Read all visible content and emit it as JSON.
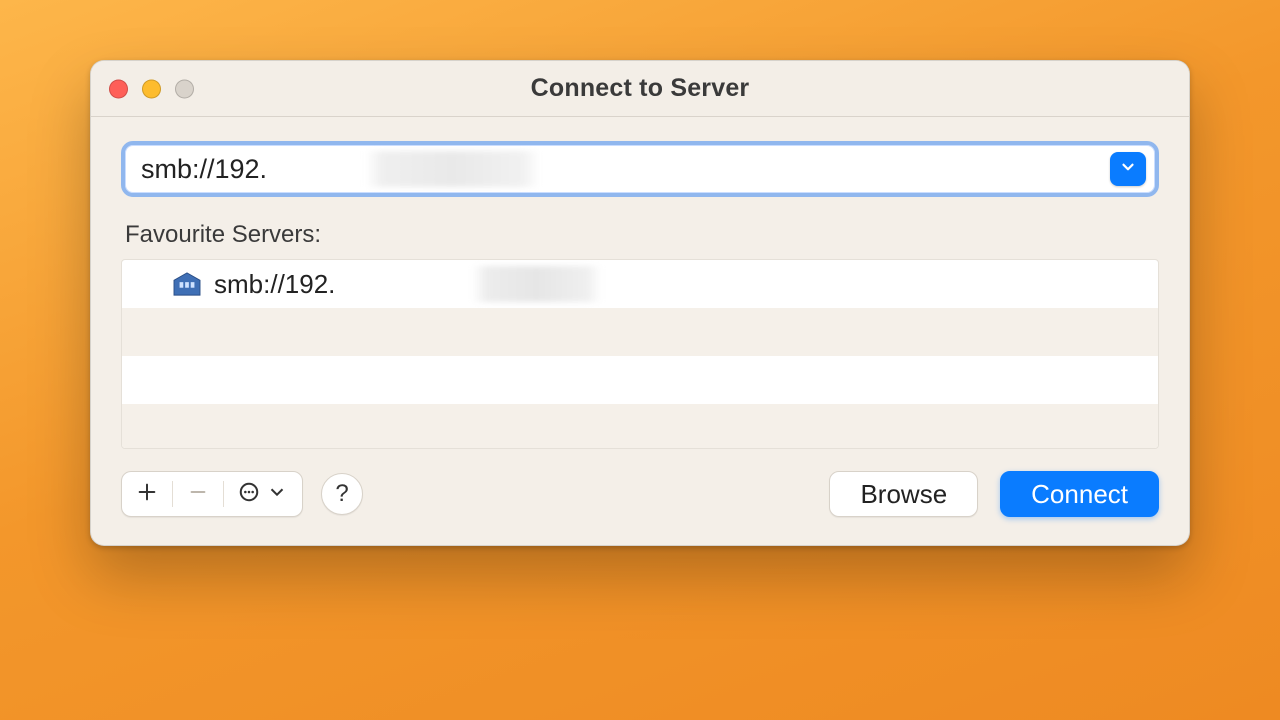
{
  "window": {
    "title": "Connect to Server"
  },
  "colors": {
    "accent": "#0a7cff",
    "focus_ring": "#90b7ee",
    "background_outer": "#f3972b",
    "window_bg": "#f4efe8"
  },
  "address": {
    "value": "smb://192.",
    "placeholder": ""
  },
  "icons": {
    "history_dropdown": "chevron-down-icon",
    "close": "close-icon",
    "minimize": "minimize-icon",
    "zoom": "zoom-icon",
    "server": "server-icon"
  },
  "favourites": {
    "label": "Favourite Servers:",
    "items": [
      {
        "icon": "server-icon",
        "address": "smb://192."
      }
    ]
  },
  "toolbar": {
    "add_tooltip": "Add",
    "remove_tooltip": "Remove",
    "remove_enabled": false,
    "more_tooltip": "More",
    "help_label": "?",
    "browse_label": "Browse",
    "connect_label": "Connect"
  }
}
